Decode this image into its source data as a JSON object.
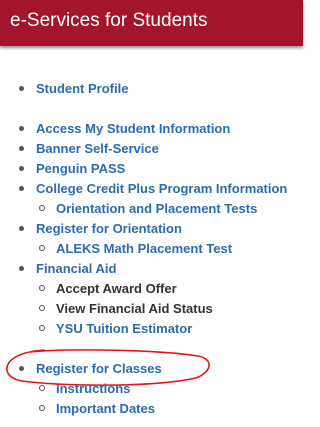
{
  "header": {
    "title": "e-Services for Students"
  },
  "colors": {
    "header_bg": "#a4142b",
    "link": "#2b6cb0",
    "plain_text": "#333333",
    "annotation": "#e8141b"
  },
  "menu": {
    "student_profile": "Student Profile",
    "access_info": "Access My Student Information",
    "banner": "Banner Self-Service",
    "penguin_pass": "Penguin PASS",
    "ccp_info": "College Credit Plus Program Information",
    "orientation_tests": "Orientation and Placement Tests",
    "register_orientation": "Register for Orientation",
    "aleks": "ALEKS Math Placement Test",
    "financial_aid": "Financial Aid",
    "accept_award": "Accept Award Offer",
    "view_fa_status": "View Financial Aid Status",
    "tuition_estimator": "YSU Tuition Estimator",
    "register_classes": "Register for Classes",
    "instructions": "Instructions",
    "important_dates": "Important Dates"
  },
  "annotation": {
    "icon": "hand-drawn-ellipse",
    "target": "Register for Classes"
  }
}
